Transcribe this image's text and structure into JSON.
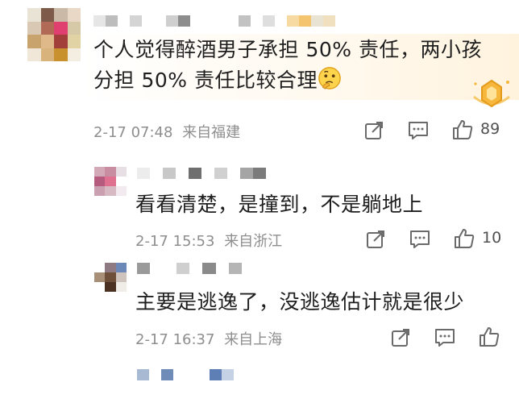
{
  "comments": [
    {
      "text_line1": "个人觉得醉酒男子承担 50% 责任，两小孩",
      "text_line2": "分担 50% 责任比较合理",
      "emoji": "thinking-face",
      "time": "2-17 07:48",
      "location": "来自福建",
      "likes": "89"
    },
    {
      "text": "看看清楚，是撞到，不是躺地上",
      "time": "2-17 15:53",
      "location": "来自浙江",
      "likes": "10"
    },
    {
      "text": "主要是逃逸了，没逃逸估计就是很少",
      "time": "2-17 16:37",
      "location": "来自上海",
      "likes": ""
    }
  ],
  "colors": {
    "text": "#1e1e1e",
    "meta": "#8e8e8e",
    "icon": "#6a6a6a",
    "badge_gold": "#f6b73c"
  }
}
